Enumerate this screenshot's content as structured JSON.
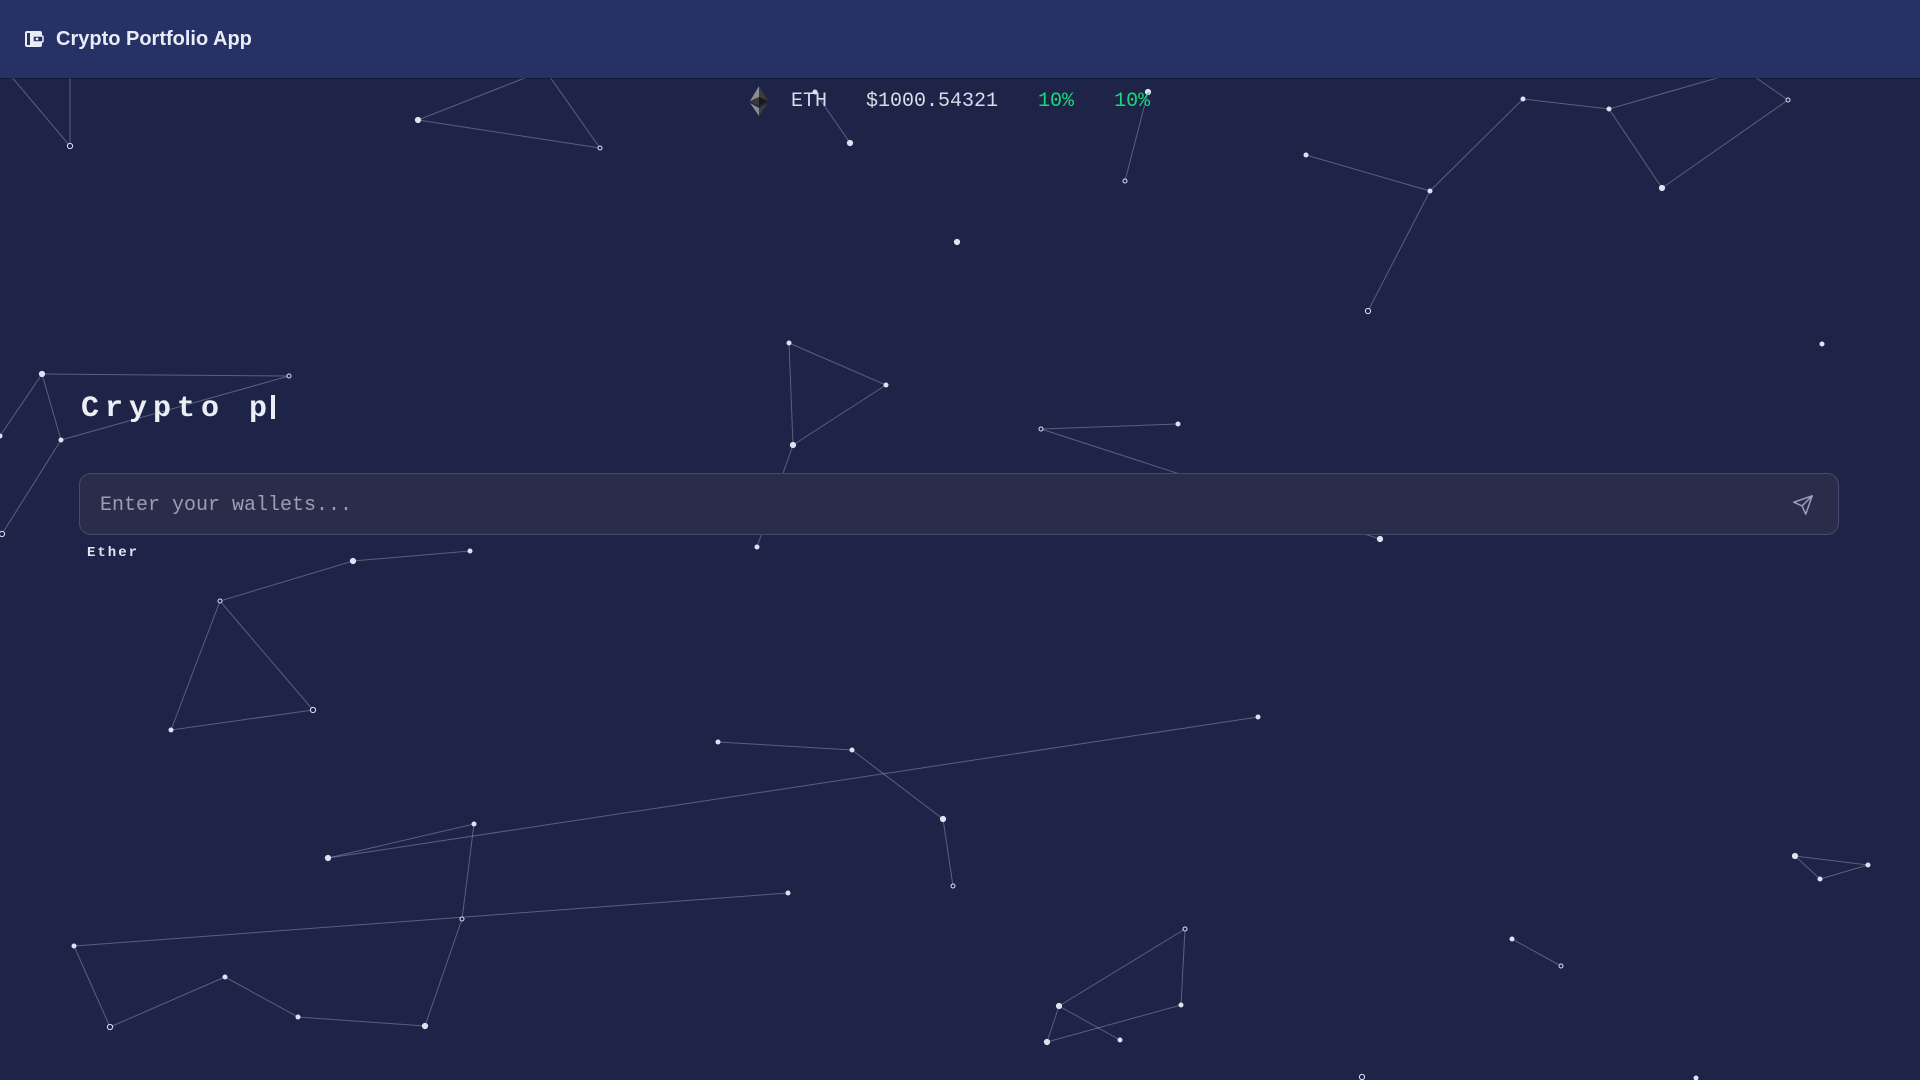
{
  "header": {
    "title": "Crypto Portfolio App",
    "logo_icon": "wallet-icon"
  },
  "ticker": {
    "icon": "ethereum-icon",
    "symbol": "ETH",
    "price": "$1000.54321",
    "change_1": "10%",
    "change_2": "10%",
    "change_color": "#17d97a"
  },
  "hero": {
    "typed_title": "Crypto p"
  },
  "wallet_search": {
    "placeholder": "Enter your wallets...",
    "value": "",
    "send_icon": "send-icon"
  },
  "suggestions": [
    {
      "label": "Ether"
    }
  ],
  "theme": {
    "background": "#1e2447",
    "header_background": "#263166",
    "input_background": "#2a2d4a"
  }
}
